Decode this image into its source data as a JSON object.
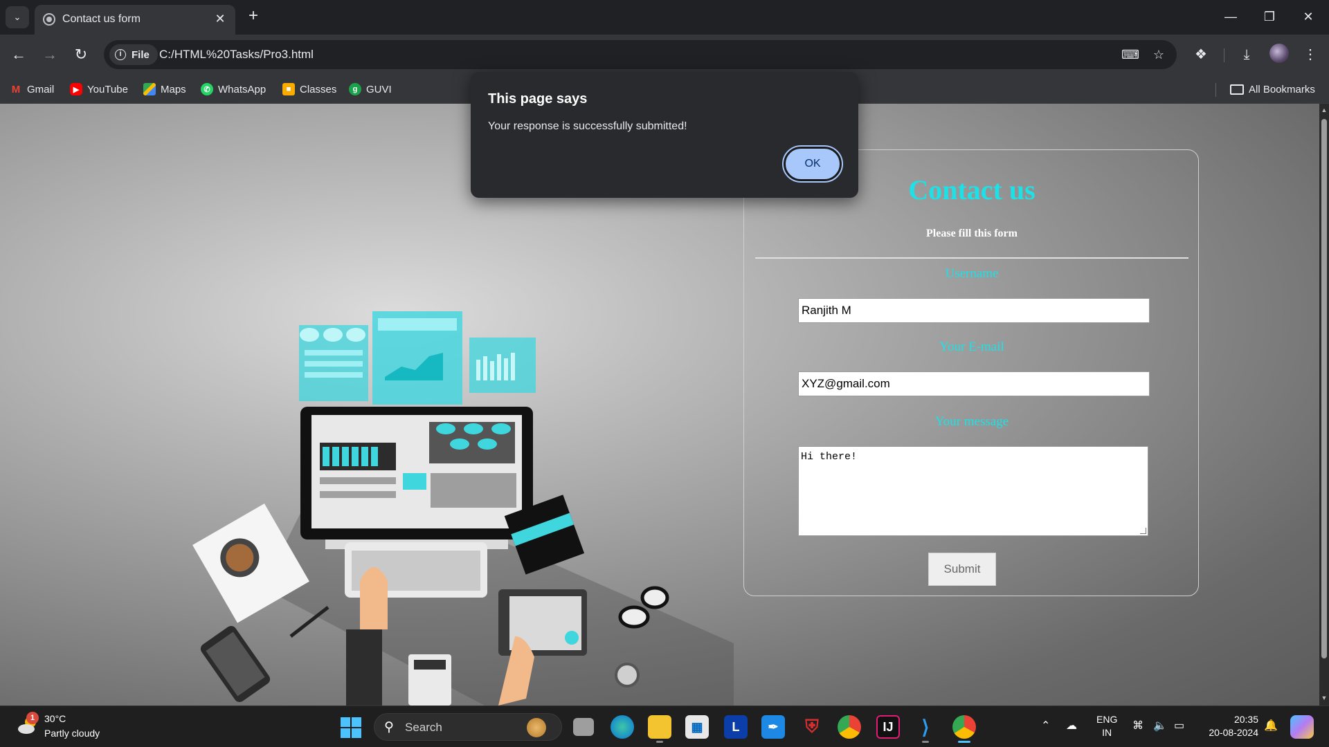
{
  "browser": {
    "tab_title": "Contact us form",
    "chip_label": "File",
    "url": "C:/HTML%20Tasks/Pro3.html",
    "icons": [
      "chevron-down-icon",
      "globe-icon",
      "close-icon",
      "plus-icon",
      "back-icon",
      "forward-icon",
      "reload-icon",
      "info-icon",
      "translate-icon",
      "star-icon",
      "extensions-icon",
      "download-icon",
      "profile-avatar",
      "more-icon"
    ]
  },
  "bookmarks": {
    "items": [
      {
        "label": "Gmail",
        "icon": "gmail-icon",
        "color": "#ea4335"
      },
      {
        "label": "YouTube",
        "icon": "youtube-icon",
        "color": "#ff0000"
      },
      {
        "label": "Maps",
        "icon": "maps-icon",
        "color": "#34a853"
      },
      {
        "label": "WhatsApp",
        "icon": "whatsapp-icon",
        "color": "#25d366"
      },
      {
        "label": "Classes",
        "icon": "classroom-icon",
        "color": "#f9ab00"
      },
      {
        "label": "GUVI",
        "icon": "guvi-icon",
        "color": "#1aa34a"
      }
    ],
    "all_bookmarks": "All Bookmarks"
  },
  "dialog": {
    "title": "This page says",
    "message": "Your response is successfully submitted!",
    "ok_label": "OK"
  },
  "form": {
    "title": "Contact us",
    "subtitle": "Please fill this form",
    "username_label": "Username",
    "username_value": "Ranjith M",
    "email_label": "Your E-mail",
    "email_value": "XYZ@gmail.com",
    "message_label": "Your message",
    "message_value": "Hi there!",
    "submit_label": "Submit",
    "accent_color": "#1de1e6"
  },
  "taskbar": {
    "weather_badge": "1",
    "weather_temp": "30°C",
    "weather_desc": "Partly cloudy",
    "search_label": "Search",
    "lang_top": "ENG",
    "lang_bottom": "IN",
    "time": "20:35",
    "date": "20-08-2024"
  }
}
